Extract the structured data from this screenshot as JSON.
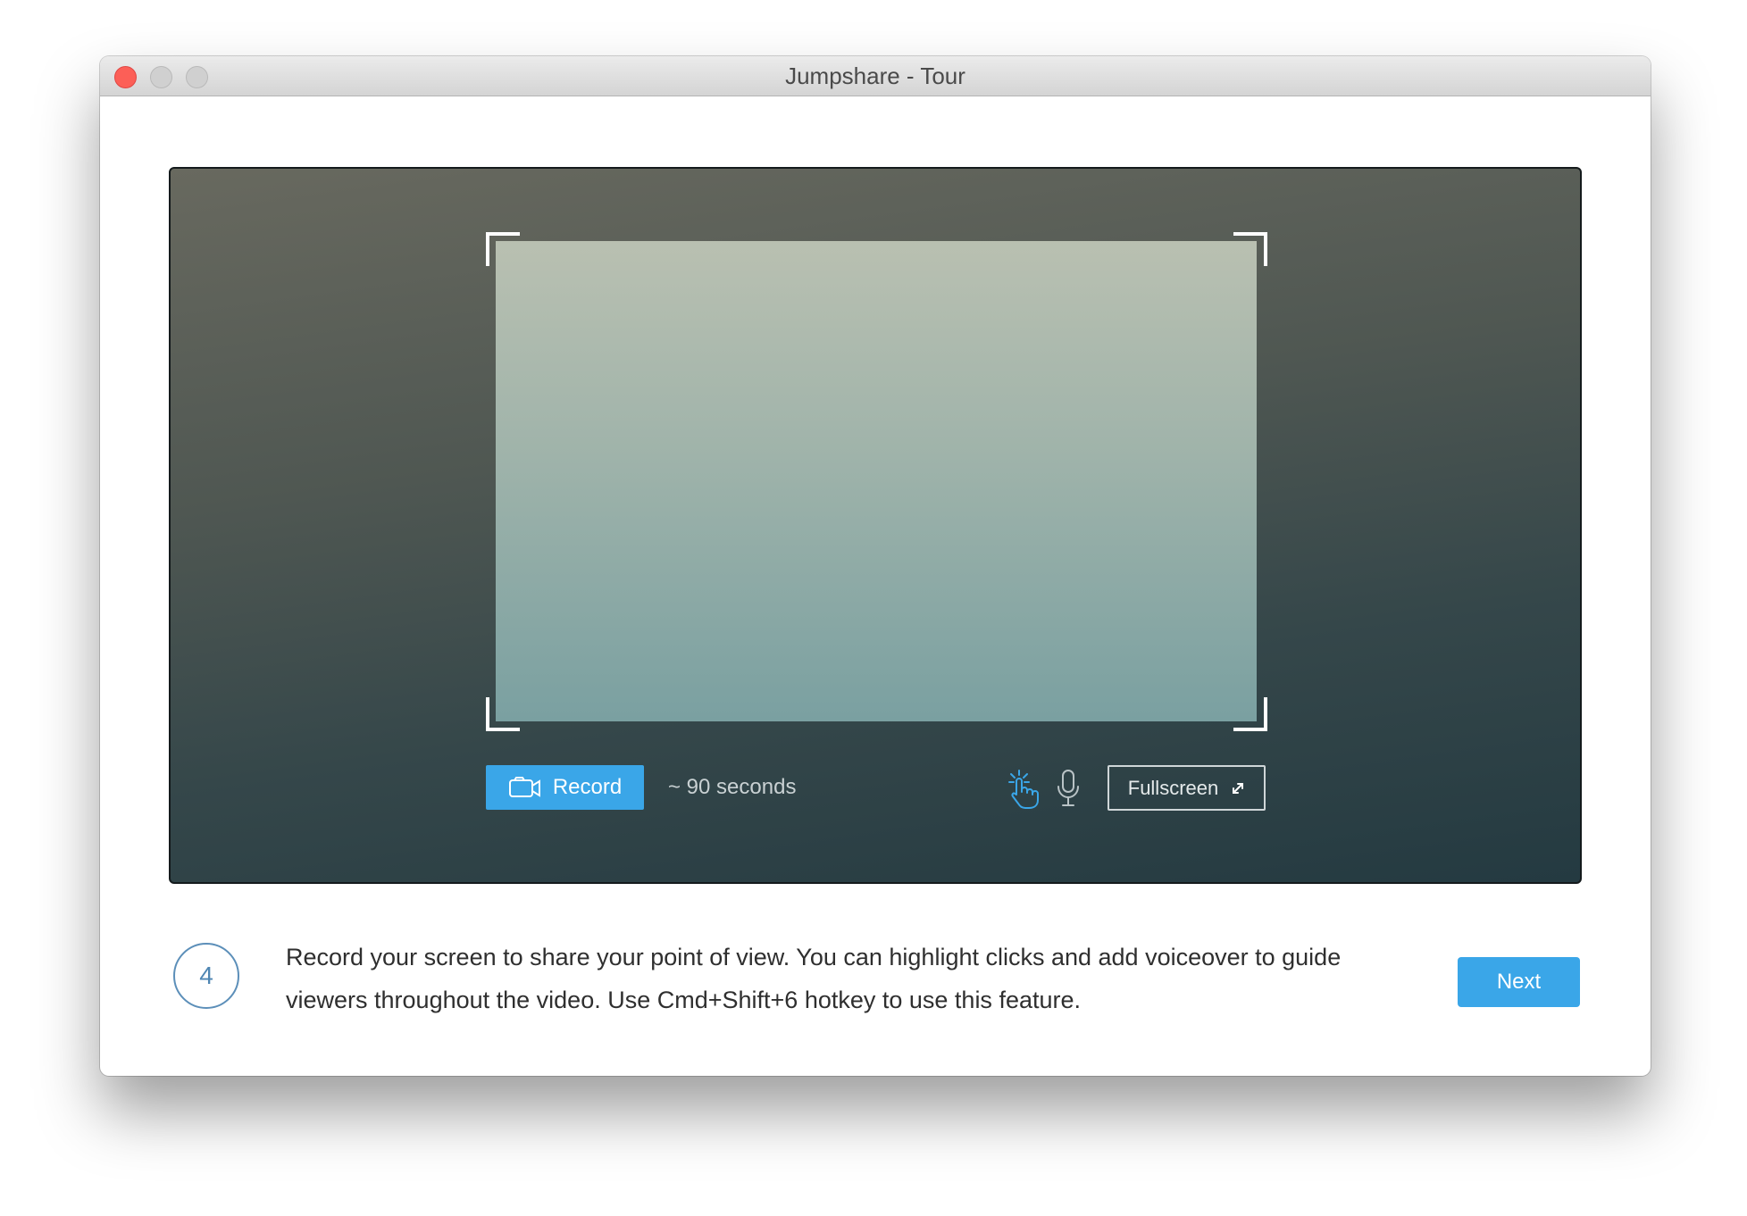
{
  "window": {
    "title": "Jumpshare - Tour"
  },
  "preview": {
    "record_label": "Record",
    "duration": "~ 90 seconds",
    "fullscreen_label": "Fullscreen",
    "icons": [
      "video-camera-icon",
      "click-highlight-icon",
      "microphone-icon",
      "expand-icon"
    ]
  },
  "step": {
    "number": "4",
    "description_line1": "Record your screen to share your point of view. You can highlight clicks and add voiceover to guide",
    "description_line2": "viewers throughout the video. Use Cmd+Shift+6 hotkey to use this feature."
  },
  "actions": {
    "next_label": "Next"
  },
  "colors": {
    "accent": "#3aa6e8",
    "close": "#fc5f57",
    "step_ring": "#5c8fb9"
  }
}
